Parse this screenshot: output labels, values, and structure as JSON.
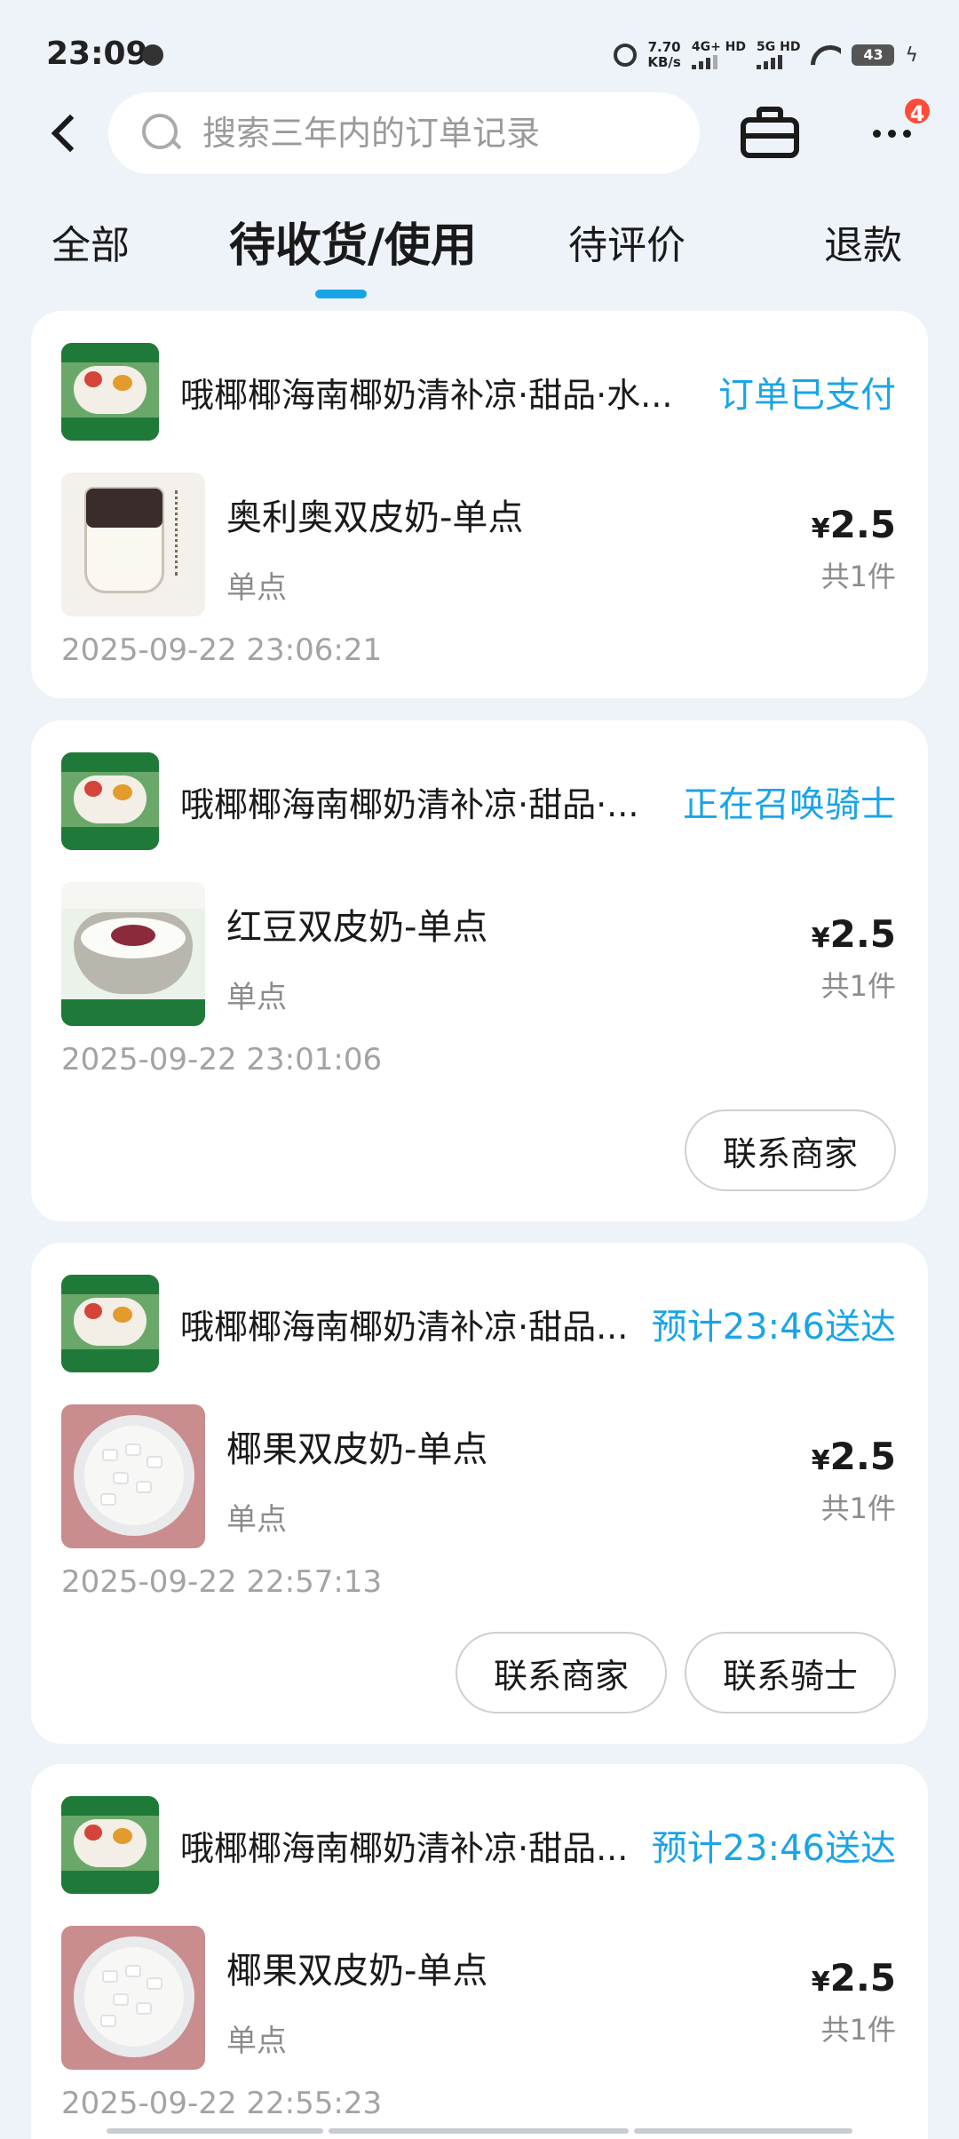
{
  "status_bar": {
    "time": "23:09",
    "speed_top": "7.70",
    "speed_unit": "KB/s",
    "net1": "4G+ HD",
    "net2": "5G HD",
    "battery": "43"
  },
  "header": {
    "search_placeholder": "搜索三年内的订单记录",
    "more_badge": "4"
  },
  "tabs": [
    {
      "label": "全部"
    },
    {
      "label": "待收货/使用",
      "active": true
    },
    {
      "label": "待评价"
    },
    {
      "label": "退款"
    }
  ],
  "orders": [
    {
      "store": "哦椰椰海南椰奶清补凉·甜品·水...",
      "status": "订单已支付",
      "product": "奥利奥双皮奶-单点",
      "spec": "单点",
      "currency": "¥",
      "price": "2.5",
      "qty": "共1件",
      "time": "2025-09-22 23:06:21",
      "actions": []
    },
    {
      "store": "哦椰椰海南椰奶清补凉·甜品·...",
      "status": "正在召唤骑士",
      "product": "红豆双皮奶-单点",
      "spec": "单点",
      "currency": "¥",
      "price": "2.5",
      "qty": "共1件",
      "time": "2025-09-22 23:01:06",
      "actions": [
        "联系商家"
      ]
    },
    {
      "store": "哦椰椰海南椰奶清补凉·甜品...",
      "status": "预计23:46送达",
      "product": "椰果双皮奶-单点",
      "spec": "单点",
      "currency": "¥",
      "price": "2.5",
      "qty": "共1件",
      "time": "2025-09-22 22:57:13",
      "actions": [
        "联系商家",
        "联系骑士"
      ]
    },
    {
      "store": "哦椰椰海南椰奶清补凉·甜品...",
      "status": "预计23:46送达",
      "product": "椰果双皮奶-单点",
      "spec": "单点",
      "currency": "¥",
      "price": "2.5",
      "qty": "共1件",
      "time": "2025-09-22 22:55:23",
      "actions": []
    }
  ],
  "colors": {
    "accent": "#1aa4e8",
    "background": "#eef3f9",
    "badge": "#ff4b3a"
  }
}
